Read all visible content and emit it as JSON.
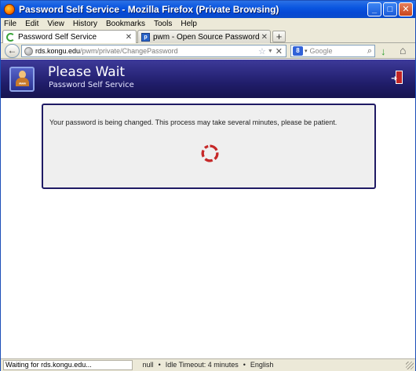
{
  "window": {
    "title": "Password Self Service - Mozilla Firefox (Private Browsing)",
    "controls": {
      "minimize": "_",
      "maximize": "□",
      "close": "✕"
    }
  },
  "menubar": {
    "items": [
      {
        "label": "File"
      },
      {
        "label": "Edit"
      },
      {
        "label": "View"
      },
      {
        "label": "History"
      },
      {
        "label": "Bookmarks"
      },
      {
        "label": "Tools"
      },
      {
        "label": "Help"
      }
    ]
  },
  "tabs": [
    {
      "label": "Password Self Service",
      "icon": "loading-spinner-icon",
      "active": true
    },
    {
      "label": "pwm - Open Source Password Self Servic...",
      "icon": "pwm-favicon-icon",
      "active": false
    }
  ],
  "navbar": {
    "url_host": "rds.kongu.edu",
    "url_path": "/pwm/private/ChangePassword",
    "search_engine": "Google",
    "search_placeholder": "Google"
  },
  "page": {
    "header": {
      "title": "Please Wait",
      "subtitle": "Password Self Service"
    },
    "wait_message": "Your password is being changed. This process may take several minutes, please be patient.",
    "footer": {
      "user": "null",
      "idle_timeout": "Idle Timeout: 4 minutes",
      "locale": "English"
    }
  },
  "statusbar": {
    "text": "Waiting for rds.kongu.edu..."
  },
  "colors": {
    "header_top": "#3d3a9a",
    "header_bottom": "#16134e",
    "box_border": "#1f1a64",
    "spinner": "#c62828"
  }
}
